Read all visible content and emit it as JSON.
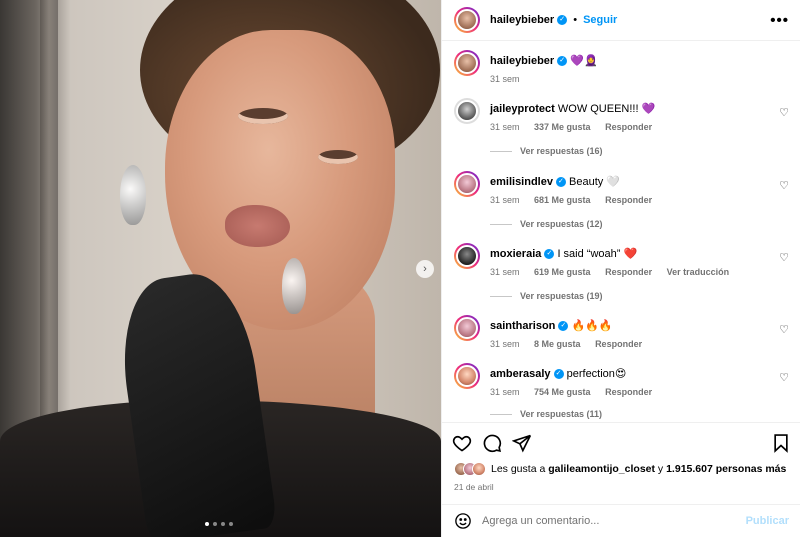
{
  "header": {
    "username": "haileybieber",
    "dot": "•",
    "follow_label": "Seguir",
    "more": "•••"
  },
  "caption": {
    "username": "haileybieber",
    "text": "💜🧕",
    "time": "31 sem"
  },
  "comments": [
    {
      "username": "jaileyprotect",
      "text": "WOW QUEEN!!! 💜",
      "verified": false,
      "time": "31 sem",
      "likes": "337 Me gusta",
      "reply": "Responder",
      "replies": "Ver respuestas (16)"
    },
    {
      "username": "emilisindlev",
      "text": "Beauty 🤍",
      "verified": true,
      "time": "31 sem",
      "likes": "681 Me gusta",
      "reply": "Responder",
      "replies": "Ver respuestas (12)"
    },
    {
      "username": "moxieraia",
      "text": "I said “woah” ❤️",
      "verified": true,
      "time": "31 sem",
      "likes": "619 Me gusta",
      "reply": "Responder",
      "translate": "Ver traducción",
      "replies": "Ver respuestas (19)"
    },
    {
      "username": "saintharison",
      "text": "🔥🔥🔥",
      "verified": true,
      "time": "31 sem",
      "likes": "8 Me gusta",
      "reply": "Responder"
    },
    {
      "username": "amberasaly",
      "text": "perfection😍",
      "verified": true,
      "time": "31 sem",
      "likes": "754 Me gusta",
      "reply": "Responder",
      "replies": "Ver respuestas (11)"
    }
  ],
  "likes_line": {
    "prefix": "Les gusta a",
    "user": "galileamontijo_closet",
    "mid": "y",
    "count": "1.915.607 personas más"
  },
  "date": "21 de abril",
  "composer": {
    "placeholder": "Agrega un comentario...",
    "post_label": "Publicar"
  },
  "carousel": {
    "next": "›",
    "slide_count": 4,
    "active_index": 0
  },
  "colors": {
    "accent": "#0095f6",
    "secondary_text": "#737373"
  },
  "icons": [
    "heart-icon",
    "comment-icon",
    "share-icon",
    "bookmark-icon",
    "emoji-icon",
    "verified-icon",
    "more-icon"
  ]
}
